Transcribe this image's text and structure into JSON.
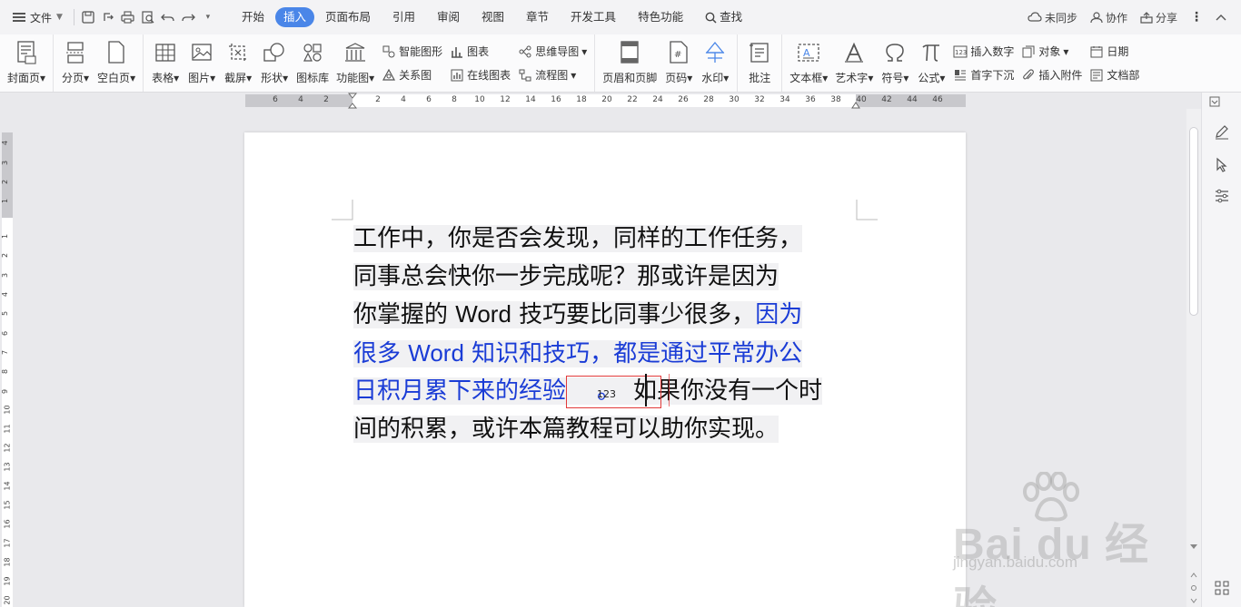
{
  "titlebar": {
    "file_menu": "文件",
    "tabs": [
      "开始",
      "插入",
      "页面布局",
      "引用",
      "审阅",
      "视图",
      "章节",
      "开发工具",
      "特色功能"
    ],
    "active_tab": "插入",
    "search": "查找",
    "right": {
      "sync": "未同步",
      "collab": "协作",
      "share": "分享"
    }
  },
  "ribbon": {
    "cover": "封面页",
    "page_break": "分页",
    "blank_page": "空白页",
    "table": "表格",
    "picture": "图片",
    "screenshot": "截屏",
    "shape": "形状",
    "icon_lib": "图标库",
    "func_chart": "功能图",
    "smart_shape": "智能图形",
    "chart": "图表",
    "mind_map": "思维导图",
    "relation": "关系图",
    "online_chart": "在线图表",
    "flowchart": "流程图",
    "header_footer": "页眉和页脚",
    "page_num": "页码",
    "watermark": "水印",
    "comment": "批注",
    "textbox": "文本框",
    "wordart": "艺术字",
    "symbol": "符号",
    "formula": "公式",
    "insert_number": "插入数字",
    "object": "对象",
    "drop_cap": "首字下沉",
    "attachment": "插入附件",
    "date": "日期",
    "doc_part": "文档部"
  },
  "ruler": {
    "h_labels": [
      "6",
      "4",
      "2",
      "2",
      "4",
      "6",
      "8",
      "10",
      "12",
      "14",
      "16",
      "18",
      "20",
      "22",
      "24",
      "26",
      "28",
      "30",
      "32",
      "34",
      "36",
      "38",
      "40",
      "42",
      "44",
      "46"
    ],
    "v_labels": [
      "4",
      "3",
      "2",
      "1",
      "1",
      "2",
      "3",
      "4",
      "5",
      "6",
      "7",
      "8",
      "9",
      "10",
      "11",
      "12",
      "13",
      "14",
      "15",
      "16",
      "17",
      "18",
      "19",
      "20"
    ]
  },
  "document": {
    "line1": "工作中，你是否会发现，同样的工作任务，",
    "line2": "同事总会快你一步完成呢？那或许是因为",
    "line3_a": "你掌握的 ",
    "line3_word": "Word",
    "line3_b": " 技巧要比同事少很多，",
    "line3_blue": "因为",
    "line4_a": "很多 ",
    "line4_word": "Word",
    "line4_b": " 知识和技巧，都是通过平常办公",
    "line5_blue": "日积月累下来的经验",
    "footnote_num": "123",
    "line5_period": "。",
    "line5_rest": "如果你没有一个时",
    "line6": "间的积累，或许本篇教程可以助你实现。"
  },
  "watermark": {
    "brand": "Bai du 经验",
    "url": "jingyan.baidu.com"
  }
}
